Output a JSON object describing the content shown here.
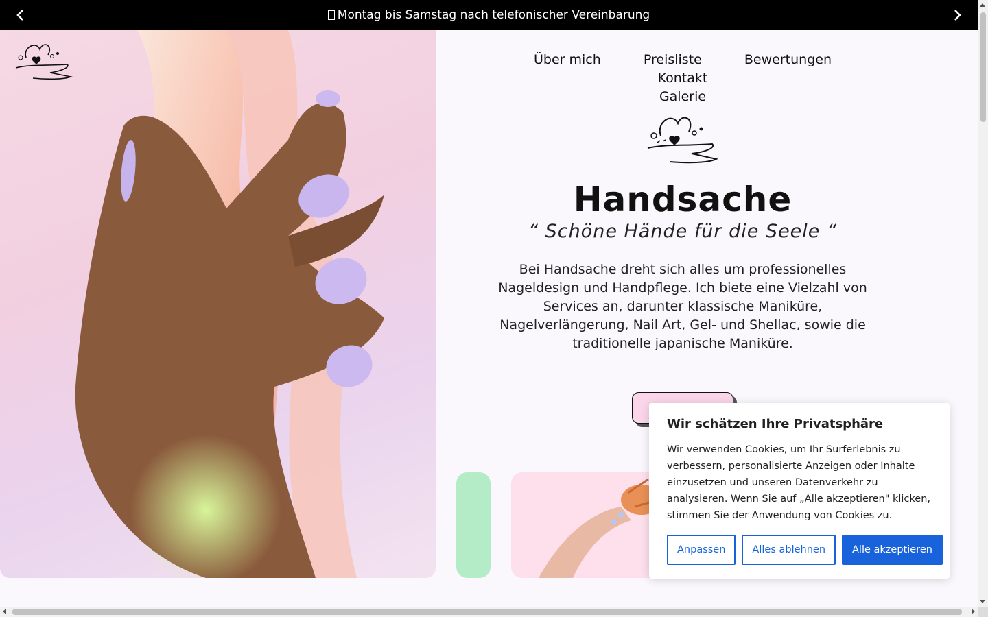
{
  "announcement": {
    "text": "Montag bis Samstag nach telefonischer Vereinbarung",
    "prev_icon": "chevron-left-icon",
    "next_icon": "chevron-right-icon"
  },
  "nav": {
    "items": [
      {
        "label": "Über mich"
      },
      {
        "label": "Preisliste"
      },
      {
        "label": "Bewertungen"
      },
      {
        "label": "Kontakt"
      },
      {
        "label": "Galerie"
      }
    ]
  },
  "hero": {
    "title": "Handsache",
    "tagline": "“ Schöne Hände für die Seele “",
    "description": "Bei Handsache dreht sich alles um professionelles Nageldesign und Handpflege. Ich biete eine Vielzahl von Services an, darunter klassische Maniküre, Nagelverlängerung, Nail Art, Gel- und Shellac, sowie die traditionelle japanische Maniküre."
  },
  "cookie_banner": {
    "title": "Wir schätzen Ihre Privatsphäre",
    "body": "Wir verwenden Cookies, um Ihr Surferlebnis zu verbessern, personalisierte Anzeigen oder Inhalte einzusetzen und unseren Datenverkehr zu analysieren. Wenn Sie auf „Alle akzeptieren\" klicken, stimmen Sie der Anwendung von Cookies zu.",
    "customize_label": "Anpassen",
    "reject_label": "Alles ablehnen",
    "accept_label": "Alle akzeptieren"
  },
  "colors": {
    "topbar": "#000000",
    "cta_pink": "#fbd6ea",
    "green_pill": "#b3ecc7",
    "cookie_blue": "#1863dc"
  }
}
